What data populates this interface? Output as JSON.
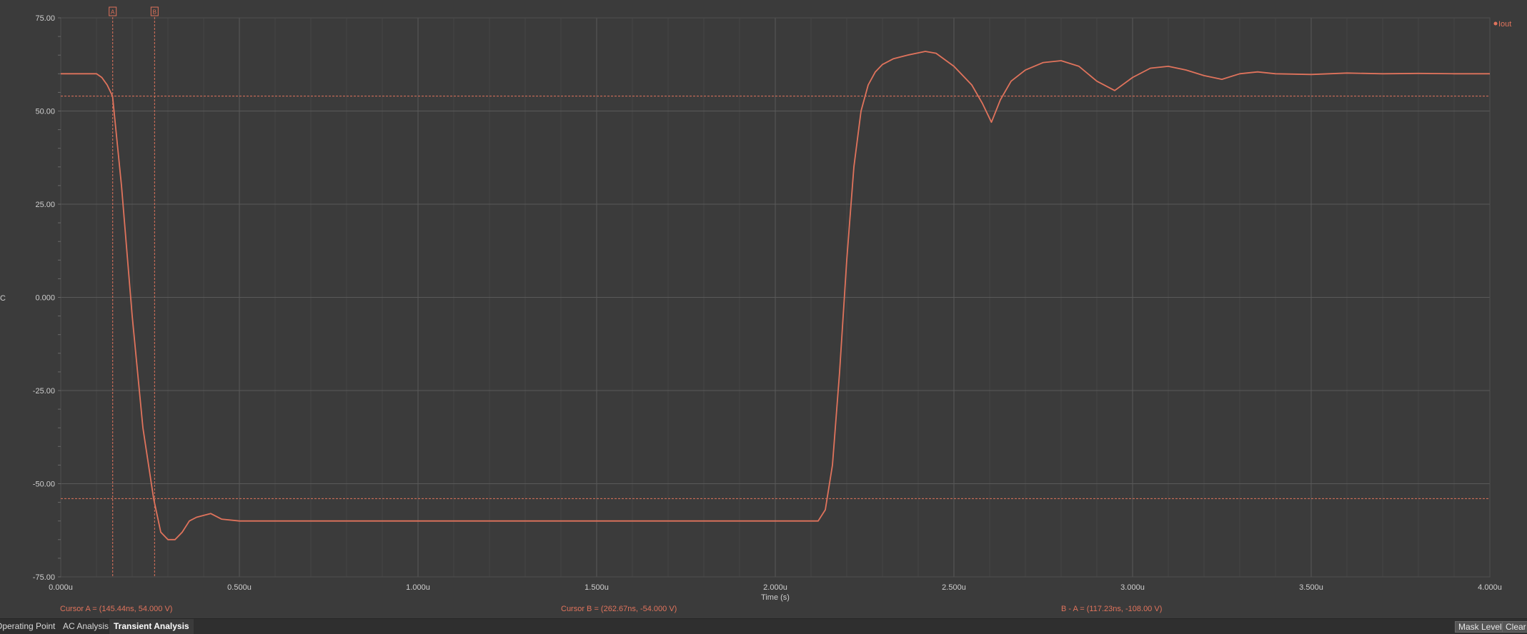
{
  "tabs": [
    {
      "label": "Operating Point",
      "active": false
    },
    {
      "label": "AC Analysis",
      "active": false
    },
    {
      "label": "Transient Analysis",
      "active": true
    }
  ],
  "buttons": {
    "mask_level": "Mask Level",
    "clear": "Clear"
  },
  "colors": {
    "background": "#3b3b3b",
    "grid": "#5a5a5a",
    "trace": "#e0735c"
  },
  "cursors": {
    "a": {
      "marker": "A",
      "x": 0.14544,
      "y": 54.0,
      "readout": "Cursor A = (145.44ns, 54.000 V)"
    },
    "b": {
      "marker": "B",
      "x": 0.26267,
      "y": -54.0,
      "readout": "Cursor B = (262.67ns, -54.000 V)"
    },
    "diff": {
      "readout": "B - A = (117.23ns, -108.00 V)"
    }
  },
  "chart_data": {
    "type": "line",
    "title": "",
    "xlabel": "Time (s)",
    "ylabel": "",
    "xlim": [
      0,
      4.0
    ],
    "ylim": [
      -75,
      75
    ],
    "grid": true,
    "legend_position": "top-right",
    "x_ticks": [
      0,
      0.5,
      1.0,
      1.5,
      2.0,
      2.5,
      3.0,
      3.5,
      4.0
    ],
    "x_tick_labels": [
      "0.000u",
      "0.500u",
      "1.000u",
      "1.500u",
      "2.000u",
      "2.500u",
      "3.000u",
      "3.500u",
      "4.000u"
    ],
    "y_ticks": [
      75,
      50,
      25,
      0,
      -25,
      -50,
      -75
    ],
    "y_tick_labels": [
      "75.00",
      "50.00",
      "25.00",
      "0.000",
      "-25.00",
      "-50.00",
      "-75.00"
    ],
    "series": [
      {
        "name": "Iout",
        "x": [
          0,
          0.05,
          0.1,
          0.115,
          0.13,
          0.145,
          0.17,
          0.2,
          0.23,
          0.26,
          0.28,
          0.3,
          0.32,
          0.34,
          0.36,
          0.38,
          0.42,
          0.45,
          0.5,
          0.55,
          0.6,
          0.7,
          1.0,
          1.5,
          2.0,
          2.12,
          2.14,
          2.16,
          2.18,
          2.2,
          2.22,
          2.24,
          2.26,
          2.28,
          2.3,
          2.33,
          2.37,
          2.42,
          2.45,
          2.5,
          2.55,
          2.58,
          2.605,
          2.63,
          2.66,
          2.7,
          2.75,
          2.8,
          2.85,
          2.9,
          2.95,
          3.0,
          3.05,
          3.1,
          3.15,
          3.2,
          3.25,
          3.3,
          3.35,
          3.4,
          3.5,
          3.6,
          3.7,
          3.8,
          3.9,
          4.0
        ],
        "y": [
          60,
          60,
          60,
          59,
          57,
          54,
          30,
          -5,
          -35,
          -54,
          -63,
          -65,
          -65,
          -63,
          -60,
          -59,
          -58,
          -59.5,
          -60,
          -60,
          -60,
          -60,
          -60,
          -60,
          -60,
          -60,
          -57,
          -45,
          -20,
          10,
          35,
          50,
          57,
          60.5,
          62.5,
          64,
          65,
          66,
          65.5,
          62,
          57,
          52,
          47,
          53,
          58,
          61,
          63,
          63.5,
          62,
          58,
          55.5,
          59,
          61.5,
          62,
          61,
          59.5,
          58.5,
          60,
          60.5,
          60,
          59.8,
          60.2,
          60,
          60.1,
          60,
          60
        ]
      }
    ]
  }
}
